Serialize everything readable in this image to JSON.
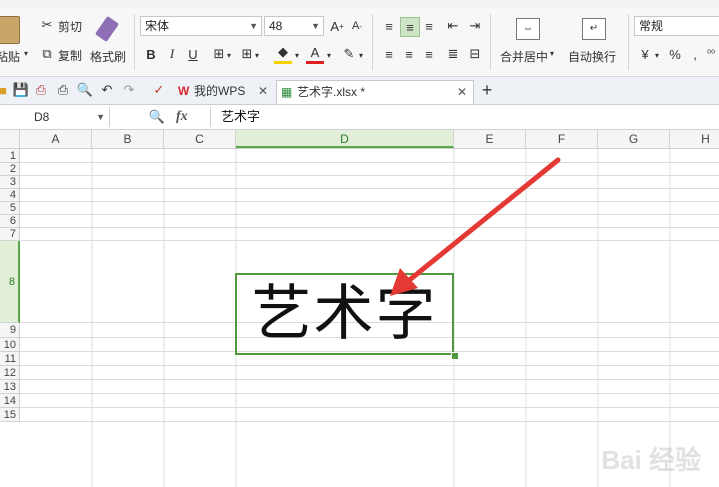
{
  "ribbon": {
    "clipboard": {
      "paste": "粘贴",
      "cut": "剪切",
      "copy": "复制",
      "format_painter": "格式刷"
    },
    "font": {
      "name": "宋体",
      "size": "48"
    },
    "merge_center": "合并居中",
    "wrap_text": "自动换行",
    "number_format": "常规",
    "percent": "%"
  },
  "tabs": [
    {
      "label": "我的WPS"
    },
    {
      "label": "艺术字.xlsx *"
    }
  ],
  "formula_bar": {
    "cell_ref": "D8",
    "fx": "fx",
    "content": "艺术字"
  },
  "columns": [
    "A",
    "B",
    "C",
    "D",
    "E",
    "F",
    "G",
    "H"
  ],
  "rows": [
    "1",
    "2",
    "3",
    "4",
    "5",
    "6",
    "7",
    "8",
    "9",
    "10",
    "11",
    "12",
    "13",
    "14",
    "15"
  ],
  "selected_cell": {
    "ref": "D8",
    "value": "艺术字"
  },
  "colors": {
    "accent": "#4e9a3c",
    "arrow": "#e53935"
  },
  "watermark": "Bai 经验"
}
